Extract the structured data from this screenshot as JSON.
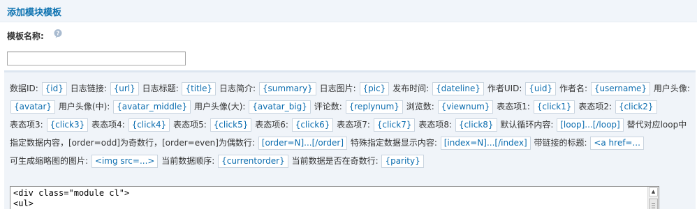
{
  "page": {
    "title": "添加模块模板"
  },
  "form": {
    "name_label": "模板名称:",
    "name_value": ""
  },
  "variables": [
    {
      "label": "数据ID:",
      "tag": "{id}"
    },
    {
      "label": "日志链接:",
      "tag": "{url}"
    },
    {
      "label": "日志标题:",
      "tag": "{title}"
    },
    {
      "label": "日志简介:",
      "tag": "{summary}"
    },
    {
      "label": "日志图片:",
      "tag": "{pic}"
    },
    {
      "label": "发布时间:",
      "tag": "{dateline}"
    },
    {
      "label": "作者UID:",
      "tag": "{uid}"
    },
    {
      "label": "作者名:",
      "tag": "{username}"
    },
    {
      "label": "用户头像:",
      "tag": "{avatar}"
    },
    {
      "label": "用户头像(中):",
      "tag": "{avatar_middle}"
    },
    {
      "label": "用户头像(大):",
      "tag": "{avatar_big}"
    },
    {
      "label": "评论数:",
      "tag": "{replynum}"
    },
    {
      "label": "浏览数:",
      "tag": "{viewnum}"
    },
    {
      "label": "表态项1:",
      "tag": "{click1}"
    },
    {
      "label": "表态项2:",
      "tag": "{click2}"
    },
    {
      "label": "表态项3:",
      "tag": "{click3}"
    },
    {
      "label": "表态项4:",
      "tag": "{click4}"
    },
    {
      "label": "表态项5:",
      "tag": "{click5}"
    },
    {
      "label": "表态项6:",
      "tag": "{click6}"
    },
    {
      "label": "表态项7:",
      "tag": "{click7}"
    },
    {
      "label": "表态项8:",
      "tag": "{click8}"
    },
    {
      "label": "默认循环内容:",
      "tag": "[loop]...[/loop]"
    },
    {
      "label": "替代对应loop中指定数据内容，[order=odd]为奇数行，[order=even]为偶数行:",
      "tag": "[order=N]...[/order]"
    },
    {
      "label": "特殊指定数据显示内容:",
      "tag": "[index=N]...[/index]"
    },
    {
      "label": "带链接的标题:",
      "tag": "<a href=..."
    },
    {
      "label": "可生成缩略图的图片:",
      "tag": "<img src=...>"
    },
    {
      "label": "当前数据顺序:",
      "tag": "{currentorder}"
    },
    {
      "label": "当前数据是否在奇数行:",
      "tag": "{parity}"
    }
  ],
  "code": {
    "lines": "<div class=\"module cl\">\n<ul>"
  },
  "colors": {
    "accent": "#0b71b0",
    "panel_bg": "#f0f4f9",
    "tag_text": "#0b6db0"
  }
}
